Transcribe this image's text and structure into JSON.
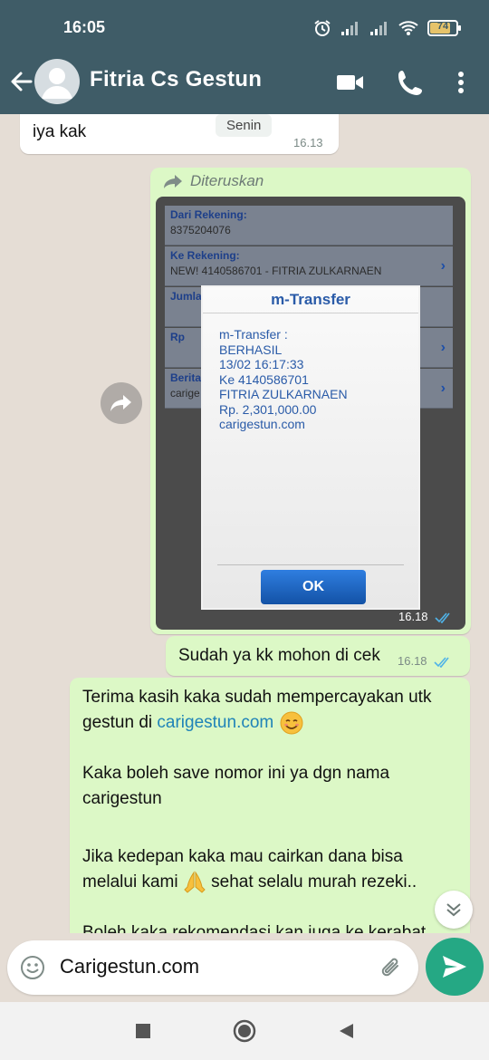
{
  "status": {
    "time": "16:05",
    "battery": "74"
  },
  "header": {
    "contact_name": "Fitria Cs Gestun"
  },
  "messages": {
    "m1": {
      "text": "iya kak",
      "chip": "Senin",
      "time": "16.13"
    },
    "m2": {
      "forwarded_label": "Diteruskan",
      "time": "16.18",
      "screenshot": {
        "rows": [
          {
            "label": "Dari Rekening:",
            "value": "8375204076"
          },
          {
            "label": "Ke Rekening:",
            "value": "NEW! 4140586701 - FITRIA ZULKARNAEN"
          },
          {
            "label": "Jumla",
            "value": ""
          },
          {
            "label": "Rp",
            "value": ""
          },
          {
            "label": "Berita",
            "value": "carige"
          }
        ],
        "dialog_title": "m-Transfer",
        "dialog_lines": [
          "m-Transfer :",
          "BERHASIL",
          "13/02 16:17:33",
          "Ke 4140586701",
          "FITRIA ZULKARNAEN",
          "Rp. 2,301,000.00",
          "carigestun.com"
        ],
        "ok_label": "OK"
      }
    },
    "m3": {
      "text": "Sudah ya kk mohon di cek",
      "time": "16.18"
    },
    "m4": {
      "line1": "Terima kasih kaka sudah mempercayakan utk",
      "line2_pre": "gestun di ",
      "line2_link": "carigestun.com",
      "line3": "Kaka boleh save nomor ini ya dgn nama",
      "line4": "carigestun",
      "line5": "Jika kedepan kaka mau cairkan dana bisa",
      "line6_pre": "melalui kami ",
      "line6_post": " sehat selalu murah rezeki..",
      "line7": "Boleh kaka rekomendasi kan juga ke kerabat"
    }
  },
  "input": {
    "value": "Carigestun.com"
  },
  "colors": {
    "header": "#3f5c67",
    "outgoing": "#dcf8c6",
    "incoming": "#ffffff",
    "send": "#25a884",
    "tick_read": "#4fb3e8"
  },
  "icons": [
    "back-arrow-icon",
    "avatar-icon",
    "video-call-icon",
    "phone-icon",
    "more-icon",
    "forward-icon",
    "share-icon",
    "double-check-icon",
    "emoji-icon",
    "attach-icon",
    "send-icon",
    "chevron-down-icon"
  ]
}
